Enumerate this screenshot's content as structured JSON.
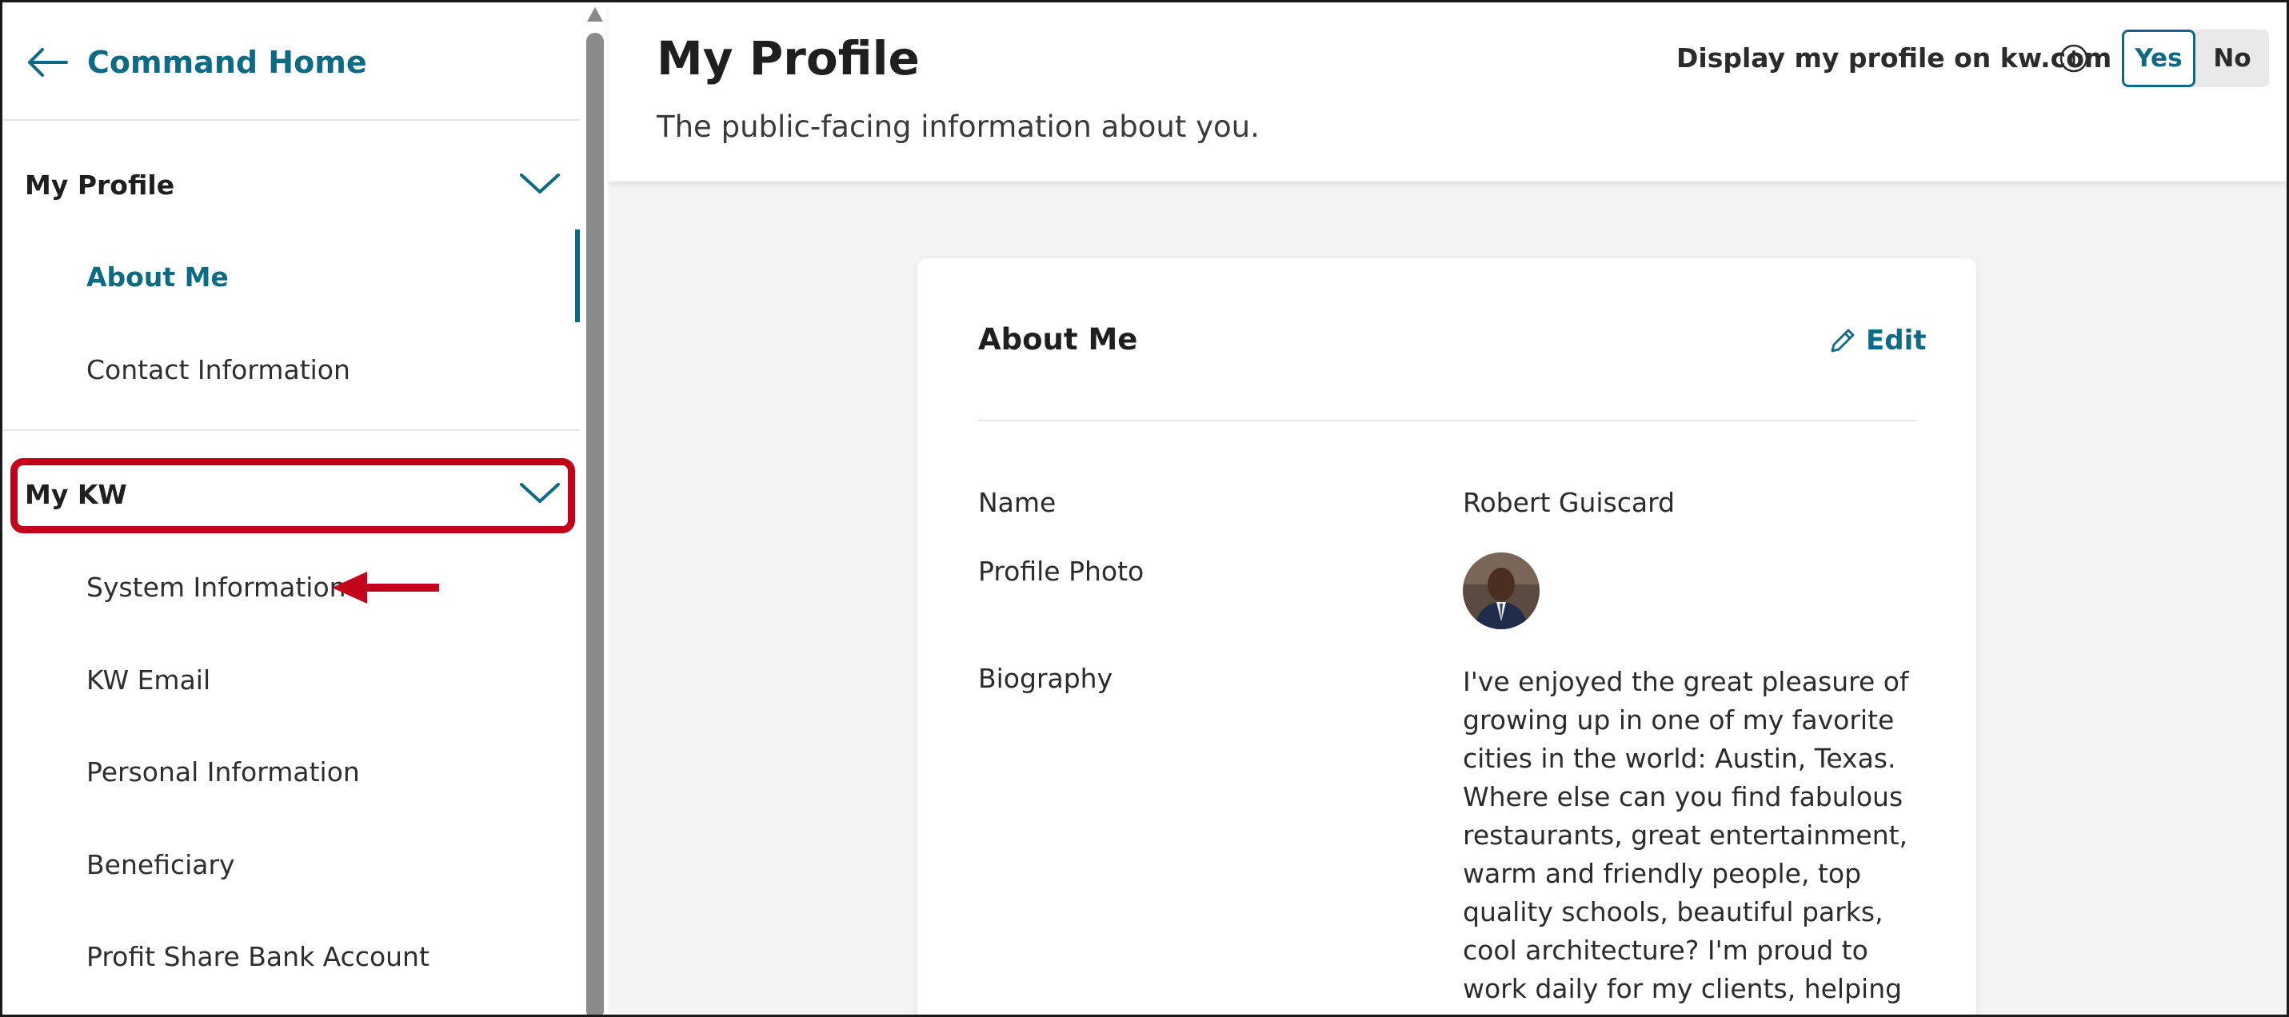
{
  "colors": {
    "accent": "#0c6a85",
    "highlight": "#c4021b"
  },
  "sidebar": {
    "back_label": "Command Home",
    "sections": [
      {
        "label": "My Profile",
        "items": [
          "About Me",
          "Contact Information"
        ]
      },
      {
        "label": "My KW",
        "items": [
          "System Information",
          "KW Email",
          "Personal Information",
          "Beneficiary",
          "Profit Share Bank Account"
        ]
      }
    ],
    "active_item": "About Me"
  },
  "header": {
    "title": "My Profile",
    "subtitle": "The public-facing information about you.",
    "display_label": "Display my profile on kw.com",
    "toggle_yes": "Yes",
    "toggle_no": "No",
    "toggle_selected": "Yes"
  },
  "card": {
    "title": "About Me",
    "edit_label": "Edit",
    "fields": {
      "name_label": "Name",
      "name_value": "Robert Guiscard",
      "photo_label": "Profile Photo",
      "bio_label": "Biography",
      "bio_value": "I've enjoyed the great pleasure of growing up in one of my favorite cities in the world: Austin, Texas. Where else can you find fabulous restaurants, great entertainment, warm and friendly people, top quality schools, beautiful parks, cool architecture? I'm proud to work daily for my clients, helping them buy and"
    }
  }
}
